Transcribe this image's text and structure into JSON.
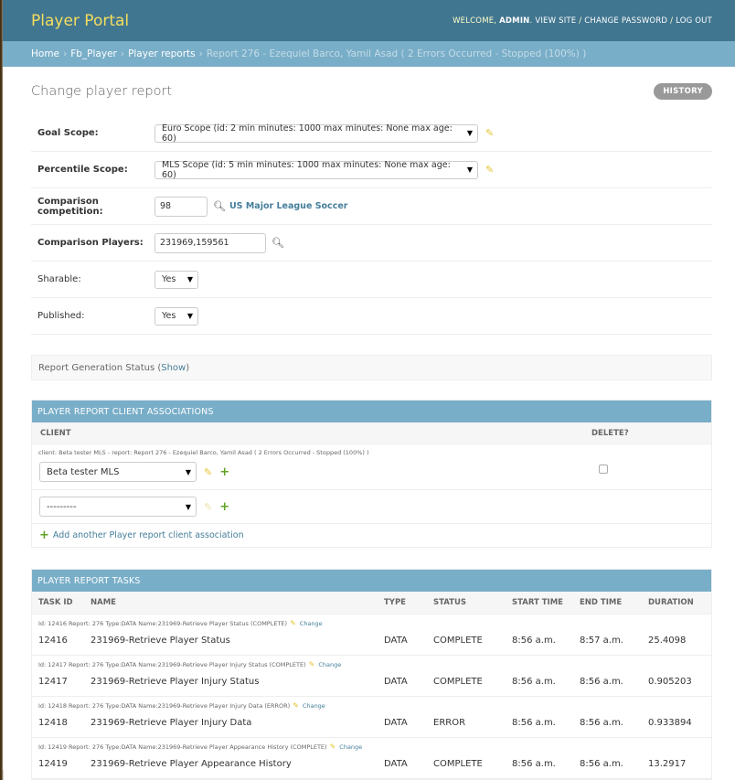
{
  "header": {
    "site_name": "Player Portal",
    "welcome": "WELCOME,",
    "user": "ADMIN",
    "view_site": "VIEW SITE",
    "change_password": "CHANGE PASSWORD",
    "log_out": "LOG OUT",
    "sep": "/"
  },
  "breadcrumbs": {
    "home": "Home",
    "app": "Fb_Player",
    "model": "Player reports",
    "current": "Report 276 - Ezequiel Barco, Yamil Asad ( 2 Errors Occurred - Stopped (100%) )",
    "sep": "›"
  },
  "page": {
    "title": "Change player report",
    "history": "HISTORY"
  },
  "form": {
    "goal_scope": {
      "label": "Goal Scope:",
      "value": "Euro Scope (id: 2 min minutes: 1000 max minutes: None max age: 60)"
    },
    "percentile_scope": {
      "label": "Percentile Scope:",
      "value": "MLS Scope (id: 5 min minutes: 1000 max minutes: None max age: 60)"
    },
    "comparison_competition": {
      "label": "Comparison competition:",
      "value": "98",
      "lookup_label": "US Major League Soccer"
    },
    "comparison_players": {
      "label": "Comparison Players:",
      "value": "231969,159561"
    },
    "sharable": {
      "label": "Sharable:",
      "value": "Yes"
    },
    "published": {
      "label": "Published:",
      "value": "Yes"
    }
  },
  "status_section": {
    "label": "Report Generation Status (",
    "show": "Show",
    "close": ")"
  },
  "associations": {
    "title": "PLAYER REPORT CLIENT ASSOCIATIONS",
    "col_client": "CLIENT",
    "col_delete": "DELETE?",
    "rows": [
      {
        "original": "client: Beta tester MLS - report: Report 276 - Ezequiel Barco, Yamil Asad ( 2 Errors Occurred - Stopped (100%) )",
        "value": "Beta tester MLS"
      },
      {
        "original": "",
        "value": "---------"
      }
    ],
    "add_another": "Add another Player report client association"
  },
  "tasks": {
    "title": "PLAYER REPORT TASKS",
    "columns": [
      "TASK ID",
      "NAME",
      "TYPE",
      "STATUS",
      "START TIME",
      "END TIME",
      "DURATION"
    ],
    "change_label": "Change",
    "rows": [
      {
        "meta": "Id: 12416 Report: 276 Type:DATA Name:231969-Retrieve Player Status (COMPLETE)",
        "id": "12416",
        "name": "231969-Retrieve Player Status",
        "type": "DATA",
        "status": "COMPLETE",
        "start": "8:56 a.m.",
        "end": "8:57 a.m.",
        "duration": "25.4098"
      },
      {
        "meta": "Id: 12417 Report: 276 Type:DATA Name:231969-Retrieve Player Injury Status (COMPLETE)",
        "id": "12417",
        "name": "231969-Retrieve Player Injury Status",
        "type": "DATA",
        "status": "COMPLETE",
        "start": "8:56 a.m.",
        "end": "8:56 a.m.",
        "duration": "0.905203"
      },
      {
        "meta": "Id: 12418 Report: 276 Type:DATA Name:231969-Retrieve Player Injury Data (ERROR)",
        "id": "12418",
        "name": "231969-Retrieve Player Injury Data",
        "type": "DATA",
        "status": "ERROR",
        "start": "8:56 a.m.",
        "end": "8:56 a.m.",
        "duration": "0.933894"
      },
      {
        "meta": "Id: 12419 Report: 276 Type:DATA Name:231969-Retrieve Player Appearance History (COMPLETE)",
        "id": "12419",
        "name": "231969-Retrieve Player Appearance History",
        "type": "DATA",
        "status": "COMPLETE",
        "start": "8:56 a.m.",
        "end": "8:56 a.m.",
        "duration": "13.2917"
      }
    ]
  },
  "icons": {
    "pencil": "pencil-icon",
    "search": "search-icon",
    "add": "plus-icon",
    "dropdown": "chevron-down-icon"
  },
  "colors": {
    "header_bg": "#417690",
    "site_name": "#f5dd5d",
    "breadcrumb_bg": "#79aec8",
    "link": "#447e9b",
    "add_green": "#5fa225",
    "edit_yellow": "#e4c530"
  }
}
